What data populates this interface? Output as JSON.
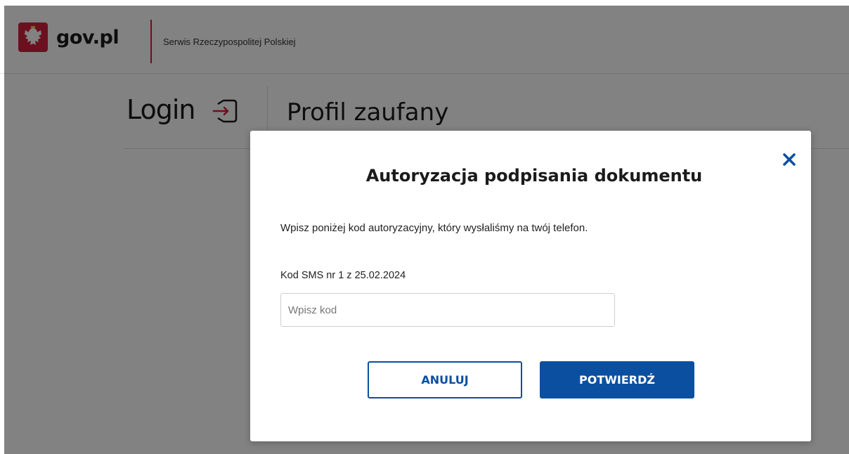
{
  "header": {
    "logo_text": "gov.pl",
    "service_name": "Serwis Rzeczypospolitej Polskiej",
    "emblem_icon": "polish-eagle-emblem-icon"
  },
  "page": {
    "login_title": "Login",
    "login_icon": "login-arrow-icon",
    "profile_title": "Profil zaufany"
  },
  "modal": {
    "title": "Autoryzacja podpisania dokumentu",
    "description": "Wpisz poniżej kod autoryzacyjny, który wysłaliśmy na twój telefon.",
    "field_label": "Kod SMS nr 1 z 25.02.2024",
    "input_placeholder": "Wpisz kod",
    "input_value": "",
    "cancel_label": "ANULUJ",
    "confirm_label": "POTWIERDŹ",
    "close_icon": "close-icon"
  },
  "colors": {
    "primary": "#0b4fa0",
    "accent_red": "#d4213d",
    "overlay": "rgba(0,0,0,0.49)"
  }
}
